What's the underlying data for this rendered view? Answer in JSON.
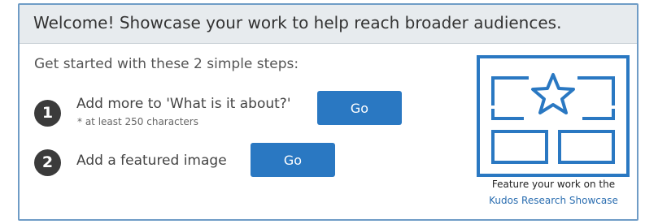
{
  "header": {
    "title": "Welcome! Showcase your work to help reach broader audiences."
  },
  "intro": "Get started with these 2 simple steps:",
  "steps": [
    {
      "number": "1",
      "label": "Add more to 'What is it about?'",
      "note": "* at least 250 characters",
      "button_label": "Go"
    },
    {
      "number": "2",
      "label": "Add a featured image",
      "button_label": "Go"
    }
  ],
  "showcase": {
    "icon": "showcase-star-icon",
    "caption_text": "Feature your work on the",
    "link_text": "Kudos Research Showcase"
  },
  "colors": {
    "accent": "#2a78c2",
    "border": "#6f9cc6",
    "header_bg": "#e7ebee",
    "step_circle": "#3b3b3b"
  }
}
